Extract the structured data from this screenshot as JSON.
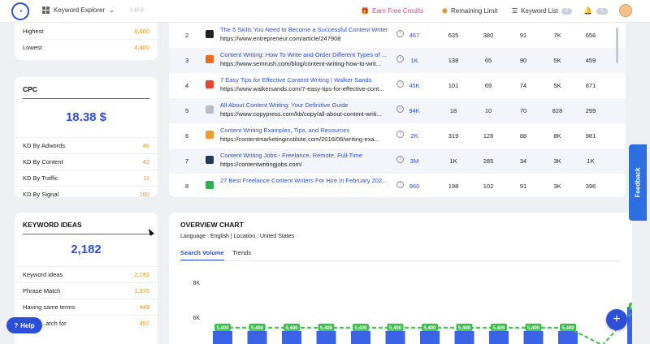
{
  "header": {
    "tool_label": "Keyword Explorer",
    "version": "1.10.0",
    "earn_label": "Earn Free Credits",
    "limit_label": "Remaining Limit",
    "kwlist_label": "Keyword List",
    "kwlist_count": "0",
    "notif_count": "0"
  },
  "volume_card": {
    "rows": [
      {
        "label": "Highest",
        "value": "6,600"
      },
      {
        "label": "Lowest",
        "value": "4,400"
      }
    ]
  },
  "cpc_card": {
    "title": "CPC",
    "value": "18.38 $",
    "rows": [
      {
        "label": "KD By Adwords",
        "value": "46"
      },
      {
        "label": "KD By Content",
        "value": "43"
      },
      {
        "label": "KD By Traffic",
        "value": "11"
      },
      {
        "label": "KD By Signal",
        "value": "100"
      }
    ]
  },
  "ideas_card": {
    "title": "KEYWORD IDEAS",
    "value": "2,182",
    "rows": [
      {
        "label": "Keyword ideas",
        "value": "2,182"
      },
      {
        "label": "Phrase Match",
        "value": "1,376"
      },
      {
        "label": "Having same terms",
        "value": "449"
      },
      {
        "label": "...arch for",
        "value": "457"
      }
    ]
  },
  "results": [
    {
      "rank": "2",
      "title": "The 5 Skills You Need to Become a Successful Content Writer",
      "url": "https://www.entrepreneur.com/article/247908",
      "c1": "467",
      "c2": "635",
      "c3": "380",
      "c4": "91",
      "c5": "7K",
      "c6": "656",
      "fav_color": "#222222"
    },
    {
      "rank": "3",
      "title": "Content Writing: How To Write and Order Different Types of ...",
      "url": "https://www.semrush.com/blog/content-writing-how-to-writ...",
      "c1": "1K",
      "c2": "138",
      "c3": "65",
      "c4": "90",
      "c5": "5K",
      "c6": "459",
      "fav_color": "#f26b1d"
    },
    {
      "rank": "4",
      "title": "7 Easy Tips for Effective Content Writing | Walker Sands",
      "url": "https://www.walkersands.com/7-easy-tips-for-effective-cont...",
      "c1": "45K",
      "c2": "101",
      "c3": "69",
      "c4": "74",
      "c5": "5K",
      "c6": "871",
      "fav_color": "#e8452c"
    },
    {
      "rank": "5",
      "title": "All About Content Writing: Your Definitive Guide",
      "url": "https://www.copypress.com/kb/copy/all-about-content-writi...",
      "c1": "94K",
      "c2": "18",
      "c3": "10",
      "c4": "70",
      "c5": "828",
      "c6": "299",
      "fav_color": "#b8bcc6"
    },
    {
      "rank": "6",
      "title": "Content Writing Examples, Tips, and Resources",
      "url": "https://contentmarketinginstitute.com/2016/06/writing-exa...",
      "c1": "2K",
      "c2": "319",
      "c3": "128",
      "c4": "88",
      "c5": "8K",
      "c6": "981",
      "fav_color": "#f29a2e"
    },
    {
      "rank": "7",
      "title": "Content Writing Jobs - Freelance, Remote, Full-Time",
      "url": "https://contentwritingjobs.com/",
      "c1": "3M",
      "c2": "1K",
      "c3": "285",
      "c4": "34",
      "c5": "3K",
      "c6": "1K",
      "fav_color": "#1f3a5a"
    },
    {
      "rank": "8",
      "title": "27 Best Freelance Content Writers For Hire In February 2022 ...",
      "url": "",
      "c1": "960",
      "c2": "198",
      "c3": "102",
      "c4": "91",
      "c5": "3K",
      "c6": "396",
      "fav_color": "#2bb24c"
    }
  ],
  "overview": {
    "title": "OVERVIEW CHART",
    "subtitle": "Language : English | Location : United States",
    "tabs": [
      "Search Volume",
      "Trends"
    ]
  },
  "chart_data": {
    "type": "bar",
    "title": "",
    "xlabel": "",
    "ylabel": "",
    "y_ticks": [
      "8K",
      "6K"
    ],
    "ylim": [
      0,
      9000
    ],
    "values": [
      5400,
      5400,
      5400,
      5400,
      5400,
      5400,
      5400,
      5400,
      5400,
      5400,
      5400,
      4400,
      6600
    ],
    "labels": [
      "5,400",
      "5,400",
      "5,400",
      "5,400",
      "5,400",
      "5,400",
      "5,400",
      "5,400",
      "5,400",
      "5,400",
      "5,400",
      "",
      "6,600"
    ],
    "bar_color": "#3b63e8",
    "line_color": "#3cbf4a"
  },
  "floating": {
    "help_label": "Help",
    "feedback_label": "Feedback",
    "fab_label": "+"
  }
}
